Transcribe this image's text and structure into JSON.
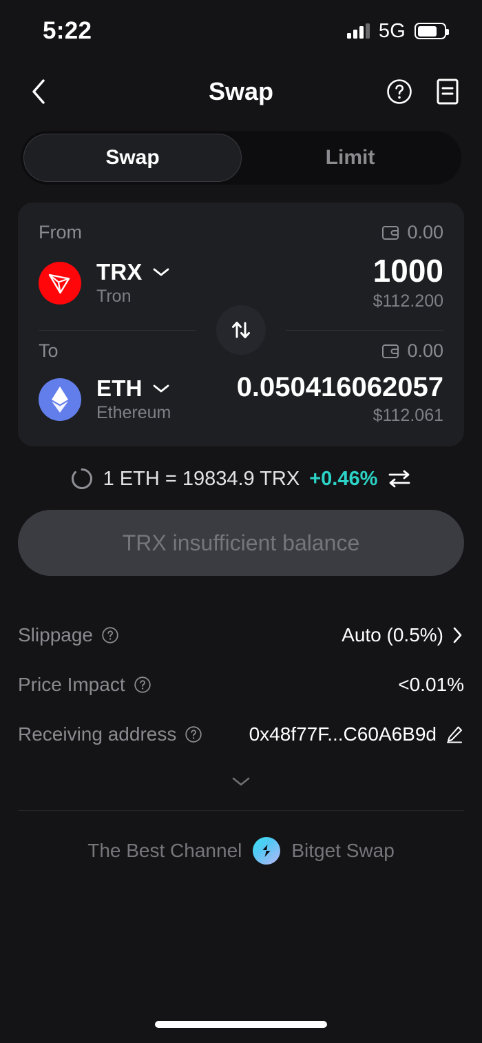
{
  "status_bar": {
    "time": "5:22",
    "network": "5G",
    "signal_icon": "signal-bars-icon",
    "battery_icon": "battery-icon",
    "battery_level": 75
  },
  "nav": {
    "back_icon": "chevron-left-icon",
    "title": "Swap",
    "help_icon": "help-circle-icon",
    "history_icon": "order-history-icon"
  },
  "tabs": [
    {
      "label": "Swap",
      "active": true
    },
    {
      "label": "Limit",
      "active": false
    }
  ],
  "swap_card": {
    "from": {
      "label": "From",
      "wallet_icon": "wallet-icon",
      "balance": "0.00",
      "token_symbol": "TRX",
      "token_name": "Tron",
      "token_logo": "tron-logo-icon",
      "token_color": "#ff060a",
      "chevron_icon": "chevron-down-icon",
      "amount": "1000",
      "amount_usd": "$112.200"
    },
    "switch_icon": "swap-vertical-icon",
    "to": {
      "label": "To",
      "wallet_icon": "wallet-icon",
      "balance": "0.00",
      "token_symbol": "ETH",
      "token_name": "Ethereum",
      "token_logo": "ethereum-logo-icon",
      "token_color": "#627eea",
      "chevron_icon": "chevron-down-icon",
      "amount": "0.050416062057",
      "amount_usd": "$112.061"
    }
  },
  "rate": {
    "refresh_icon": "refresh-spinner-icon",
    "text": "1 ETH = 19834.9 TRX",
    "change_pct": "+0.46%",
    "change_color": "#2cd4c8",
    "invert_icon": "swap-horizontal-icon"
  },
  "action_button": {
    "label": "TRX insufficient balance",
    "disabled": true
  },
  "details": [
    {
      "label": "Slippage",
      "info_icon": "info-circle-icon",
      "value": "Auto (0.5%)",
      "trailing_icon": "chevron-right-icon"
    },
    {
      "label": "Price Impact",
      "info_icon": "info-circle-icon",
      "value": "<0.01%",
      "trailing_icon": ""
    },
    {
      "label": "Receiving address",
      "info_icon": "info-circle-icon",
      "value": "0x48f77F...C60A6B9d",
      "trailing_icon": "edit-pencil-icon"
    }
  ],
  "expand_icon": "chevron-down-icon",
  "footer": {
    "text": "The Best Channel",
    "provider_logo": "bitget-logo-icon",
    "provider": "Bitget Swap"
  },
  "home_indicator": "home-indicator"
}
